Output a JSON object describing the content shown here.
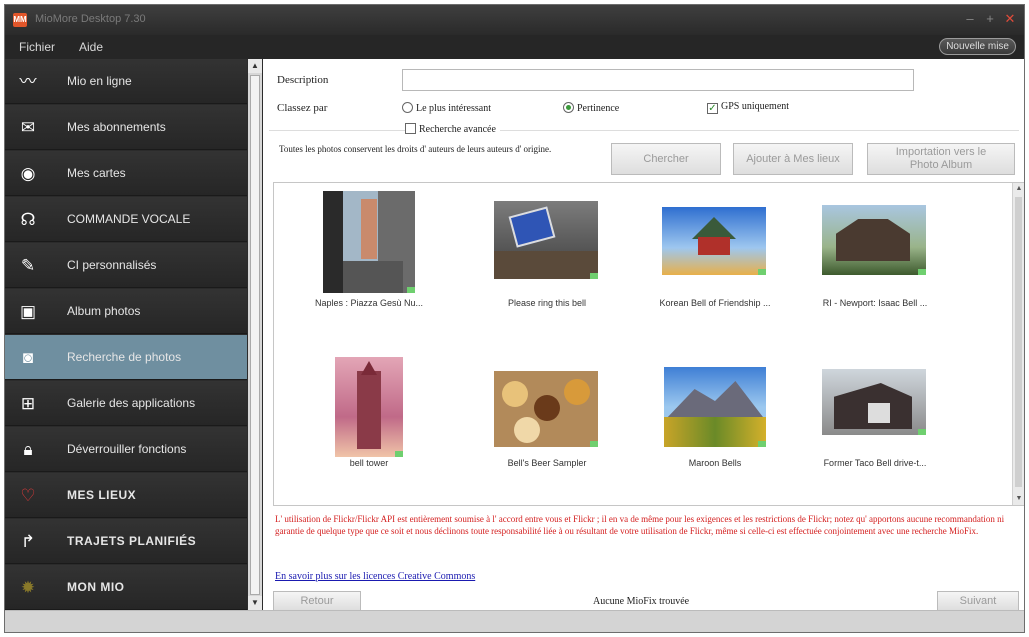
{
  "window": {
    "title": "MioMore Desktop 7.30",
    "app_icon_text": "MM"
  },
  "menu": {
    "items": [
      "Fichier",
      "Aide"
    ],
    "news_button": "Nouvelle mise"
  },
  "sidebar": {
    "items": [
      {
        "label": "Mio en ligne",
        "icon": "signal-wave-icon"
      },
      {
        "label": "Mes abonnements",
        "icon": "envelope-icon"
      },
      {
        "label": "Mes cartes",
        "icon": "compass-icon"
      },
      {
        "label": "COMMANDE VOCALE",
        "icon": "voice-icon"
      },
      {
        "label": "CI personnalisés",
        "icon": "brush-icon"
      },
      {
        "label": "Album photos",
        "icon": "album-icon"
      },
      {
        "label": "Recherche de photos",
        "icon": "camera-icon",
        "active": true
      },
      {
        "label": "Galerie des applications",
        "icon": "apps-grid-icon"
      },
      {
        "label": "Déverrouiller fonctions",
        "icon": "lock-icon"
      },
      {
        "label": "MES LIEUX",
        "icon": "heart-icon"
      },
      {
        "label": "TRAJETS PLANIFIÉS",
        "icon": "route-icon"
      },
      {
        "label": "MON MIO",
        "icon": "gear-icon"
      }
    ]
  },
  "search": {
    "description_label": "Description",
    "description_value": "",
    "sort_label": "Classez par",
    "sort_options": [
      {
        "label": "Le plus intéressant",
        "selected": false
      },
      {
        "label": "Pertinence",
        "selected": true
      }
    ],
    "gps_only": {
      "label": "GPS uniquement",
      "checked": true
    },
    "advanced": {
      "label": "Recherche avancée",
      "checked": false
    },
    "copyright_note": "Toutes les photos conservent les droits d' auteurs de leurs auteurs d' origine.",
    "buttons": {
      "search": "Chercher",
      "add_to_places": "Ajouter à Mes lieux",
      "import": "Importation vers le Photo Album"
    }
  },
  "results": [
    {
      "caption": "Naples : Piazza Gesù Nu..."
    },
    {
      "caption": "Please ring this bell"
    },
    {
      "caption": "Korean Bell of Friendship ..."
    },
    {
      "caption": "RI - Newport: Isaac Bell ..."
    },
    {
      "caption": "bell tower"
    },
    {
      "caption": "Bell's Beer Sampler"
    },
    {
      "caption": "Maroon Bells"
    },
    {
      "caption": "Former Taco Bell drive-t..."
    }
  ],
  "legal_notice": "L' utilisation de Flickr/Flickr API est entièrement soumise à l' accord entre vous et Flickr ; il en va de même pour les exigences et les restrictions de Flickr; notez qu' apportons aucune recommandation ni garantie de quelque type que ce soit et nous déclinons toute responsabilité liée à ou résultant de votre utilisation de Flickr, même si celle-ci est effectuée conjointement avec une recherche MioFix.",
  "license_link": "En savoir plus sur les licences Creative Commons",
  "footer": {
    "back": "Retour",
    "status": "Aucune MioFix trouvée",
    "next": "Suivant"
  }
}
